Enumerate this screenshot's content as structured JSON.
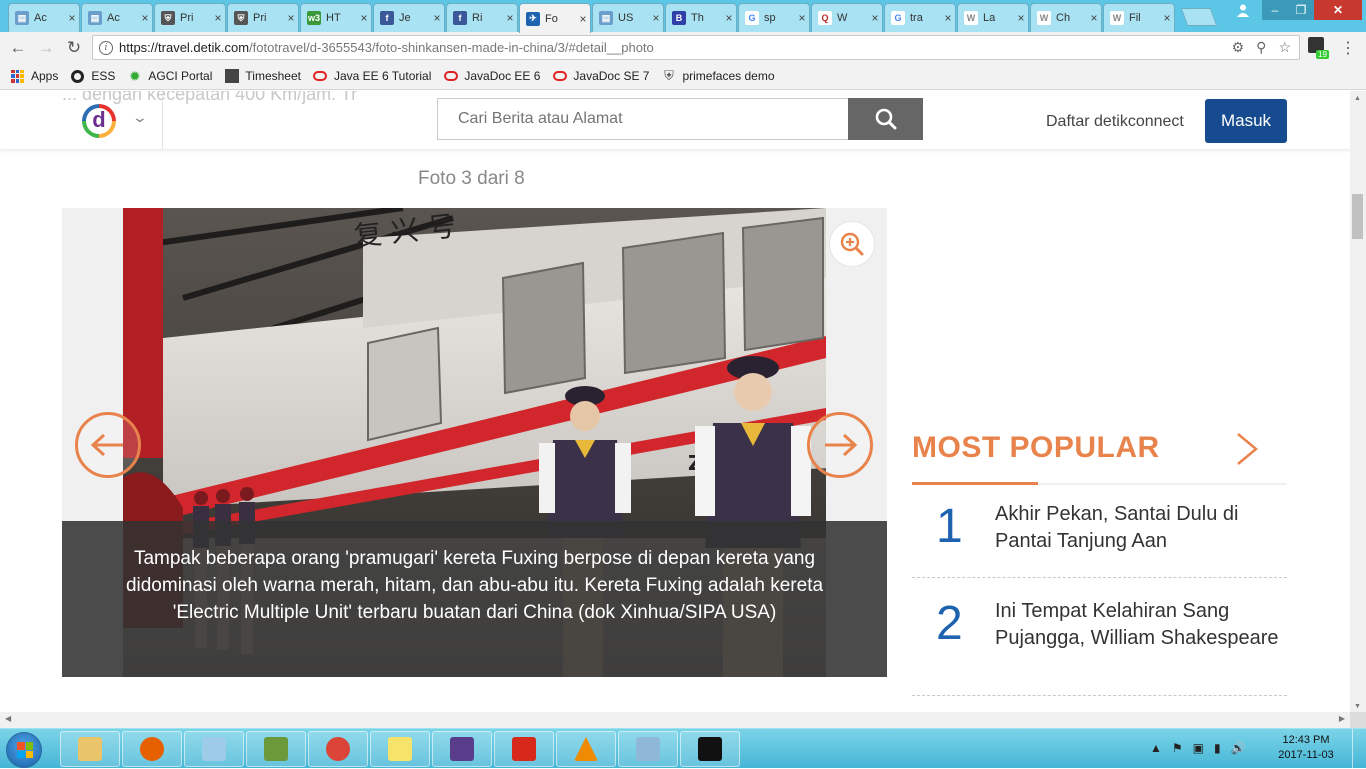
{
  "browser": {
    "tabs": [
      {
        "title": "Ac",
        "icon_color": "#6a9fcc",
        "icon": "doc-icon"
      },
      {
        "title": "Ac",
        "icon_color": "#6a9fcc",
        "icon": "doc-icon"
      },
      {
        "title": "Pri",
        "icon_color": "#555555",
        "icon": "shield-icon"
      },
      {
        "title": "Pri",
        "icon_color": "#555555",
        "icon": "shield-icon"
      },
      {
        "title": "HT",
        "icon_color": "#3a9a3a",
        "icon": "w3-icon"
      },
      {
        "title": "Je",
        "icon_color": "#3b5998",
        "icon": "facebook-icon"
      },
      {
        "title": "Ri",
        "icon_color": "#3b5998",
        "icon": "facebook-icon"
      },
      {
        "title": "Fo",
        "icon_color": "#1e63b0",
        "icon": "detik-icon"
      },
      {
        "title": "US",
        "icon_color": "#6a9fcc",
        "icon": "doc-icon"
      },
      {
        "title": "Th",
        "icon_color": "#2e3fa8",
        "icon": "b-icon"
      },
      {
        "title": "sp",
        "icon_color": "#4285f4",
        "icon": "google-icon"
      },
      {
        "title": "W",
        "icon_color": "#b92b27",
        "icon": "quora-icon"
      },
      {
        "title": "tra",
        "icon_color": "#4285f4",
        "icon": "google-icon"
      },
      {
        "title": "La",
        "icon_color": "#888888",
        "icon": "wikipedia-icon"
      },
      {
        "title": "Ch",
        "icon_color": "#888888",
        "icon": "wikipedia-icon"
      },
      {
        "title": "Fil",
        "icon_color": "#888888",
        "icon": "wikipedia-icon"
      }
    ],
    "active_tab_index": 7,
    "url_host": "https://travel.detik.com",
    "url_path": "/fototravel/d-3655543/foto-shinkansen-made-in-china/3/#detail__photo",
    "extension_badge": "19",
    "bookmarks": [
      {
        "label": "Apps",
        "icon": "apps-grid-icon"
      },
      {
        "label": "ESS",
        "icon": "ess-icon"
      },
      {
        "label": "AGCI Portal",
        "icon": "agci-icon"
      },
      {
        "label": "Timesheet",
        "icon": "eap-icon"
      },
      {
        "label": "Java EE 6 Tutorial",
        "icon": "oracle-icon"
      },
      {
        "label": "JavaDoc EE 6",
        "icon": "oracle-icon"
      },
      {
        "label": "JavaDoc SE 7",
        "icon": "oracle-icon"
      },
      {
        "label": "primefaces demo",
        "icon": "shield-icon"
      }
    ]
  },
  "site": {
    "bleed_text": "... dengan kecepatan 400 Km/jam. Tr",
    "search_placeholder": "Cari Berita atau Alamat",
    "daftar_label": "Daftar detikconnect",
    "masuk_label": "Masuk",
    "logo_letter": "d",
    "foto_count": "Foto 3 dari 8",
    "photo_sign": "复 兴 号",
    "photo_code": "ZY",
    "caption": "Tampak beberapa orang 'pramugari' kereta Fuxing berpose di depan kereta yang didominasi oleh warna merah, hitam, dan abu-abu itu. Kereta Fuxing adalah kereta 'Electric Multiple Unit' terbaru buatan dari China (dok Xinhua/SIPA USA)",
    "accent_color": "#e8834c",
    "brand_blue": "#164b8f"
  },
  "popular": {
    "title": "MOST POPULAR",
    "items": [
      {
        "rank": "1",
        "title": "Akhir Pekan, Santai Dulu di Pantai Tanjung Aan"
      },
      {
        "rank": "2",
        "title": "Ini Tempat Kelahiran Sang Pujangga, William Shakespeare"
      }
    ]
  },
  "taskbar": {
    "apps": [
      "file-explorer-icon",
      "firefox-icon",
      "notepad-icon",
      "charting-icon",
      "chrome-icon",
      "sticky-notes-icon",
      "java-ee-ide-icon",
      "acrobat-icon",
      "vlc-icon",
      "paint-icon",
      "cmd-icon"
    ],
    "time": "12:43 PM",
    "date": "2017-11-03"
  }
}
